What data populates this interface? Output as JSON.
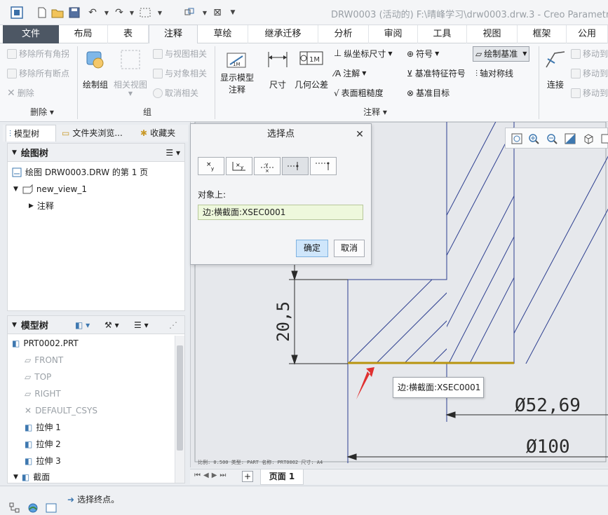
{
  "window": {
    "title": "DRW0003 (活动的) F:\\晴峰学习\\drw0003.drw.3 - Creo Parametric"
  },
  "ribbon_tabs": [
    "文件",
    "布局",
    "表",
    "注释",
    "草绘",
    "继承迁移",
    "分析",
    "审阅",
    "工具",
    "视图",
    "框架",
    "公用"
  ],
  "active_tab": "注释",
  "ribbon": {
    "delete_group": {
      "remove_all_corners": "移除所有角拐",
      "remove_all_breaks": "移除所有断点",
      "delete": "删除",
      "label": "删除"
    },
    "group_group": {
      "draw_group": "绘制组",
      "related_view": "相关视图",
      "relate_to_view": "与视图相关",
      "relate_to_object": "与对象相关",
      "unrelate": "取消相关",
      "label": "组"
    },
    "annotation_group": {
      "show_model_annotation_l1": "显示模型",
      "show_model_annotation_l2": "注释",
      "dimension": "尺寸",
      "gtol": "几何公差",
      "ordinate_dim": "纵坐标尺寸",
      "note": "注解",
      "surface_finish": "表面粗糙度",
      "symbol": "符号",
      "datum_feature_symbol": "基准特征符号",
      "datum_target": "基准目标",
      "draw_datum": "绘制基准",
      "axis_symmetry": "轴对称线",
      "label": "注释"
    },
    "right_group": {
      "connect": "连接",
      "move_to": "移动到",
      "move_to2": "移动到",
      "move_to3": "移动到"
    }
  },
  "nav_tabs": {
    "model_tree": "模型树",
    "folder_browser": "文件夹浏览...",
    "favorites": "收藏夹"
  },
  "drawing_tree": {
    "header": "绘图树",
    "items": [
      {
        "label": "绘图 DRW0003.DRW 的第 1 页"
      },
      {
        "label": "new_view_1"
      },
      {
        "label": "注释"
      }
    ]
  },
  "model_tree": {
    "header": "模型树",
    "items": [
      {
        "label": "PRT0002.PRT",
        "disabled": false
      },
      {
        "label": "FRONT",
        "disabled": true
      },
      {
        "label": "TOP",
        "disabled": true
      },
      {
        "label": "RIGHT",
        "disabled": true
      },
      {
        "label": "DEFAULT_CSYS",
        "disabled": true
      },
      {
        "label": "拉伸 1",
        "disabled": false
      },
      {
        "label": "拉伸 2",
        "disabled": false
      },
      {
        "label": "拉伸 3",
        "disabled": false
      },
      {
        "label": "截面",
        "disabled": false
      }
    ]
  },
  "dialog": {
    "title": "选择点",
    "on_object_label": "对象上:",
    "object_value": "边:横截面:XSEC0001",
    "ok": "确定",
    "cancel": "取消"
  },
  "drawing": {
    "dim_vertical": "20,5",
    "dim_diameter1": "Ø52,69",
    "dim_diameter2": "Ø100",
    "sheet_info": "比例: 0.500   类型: PART   名称: PRT0002   尺寸: A4",
    "tooltip": "边:横截面:XSEC0001"
  },
  "page_bar": {
    "page_label": "页面 1"
  },
  "status": {
    "message": "选择终点。"
  }
}
